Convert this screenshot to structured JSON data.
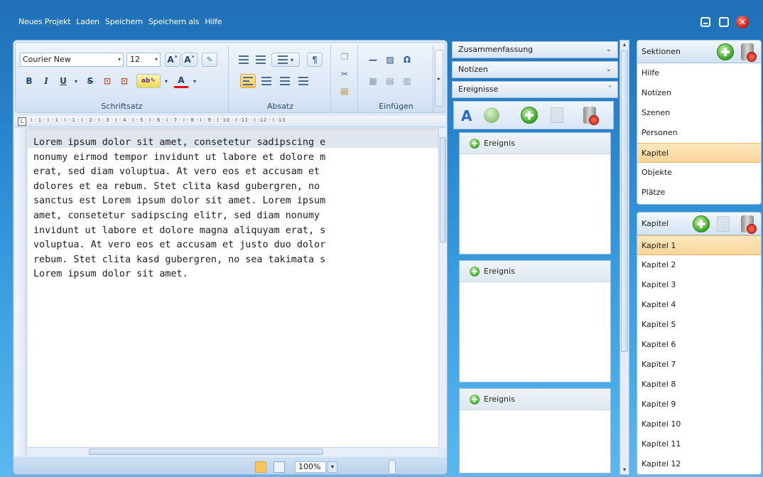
{
  "menu": {
    "items": [
      "Neues Projekt",
      "Laden",
      "Speichern",
      "Speichern als",
      "Hilfe"
    ],
    "close_glyph": "✕"
  },
  "ribbon": {
    "font_family": "Courier New",
    "font_size": "12",
    "groups": [
      "Schriftsatz",
      "Absatz",
      "Einfügen"
    ],
    "bold": "B",
    "italic": "I",
    "underline": "U",
    "strike": "S",
    "grow": "A˄",
    "shrink": "A˅",
    "font_color": "A"
  },
  "ruler": {
    "corner": "L",
    "ticks": "I · 1 · I · 1 · I · 1 · I · 2 · I · 3 · I · 4 · I · 5 · I · 6 · I · 7 · I · 8 · I · 9 · I ·10 · I ·11 · I ·12 · I ·13"
  },
  "document": {
    "text": "Lorem ipsum dolor sit amet, consetetur sadipscing e\nnonumy eirmod tempor invidunt ut labore et dolore m\nerat, sed diam voluptua. At vero eos et accusam et \ndolores et ea rebum. Stet clita kasd gubergren, no \nsanctus est Lorem ipsum dolor sit amet. Lorem ipsum\namet, consetetur sadipscing elitr, sed diam nonumy \ninvidunt ut labore et dolore magna aliquyam erat, s\nvoluptua. At vero eos et accusam et justo duo dolor\nrebum. Stet clita kasd gubergren, no sea takimata s\nLorem ipsum dolor sit amet."
  },
  "status": {
    "zoom": "100%",
    "zoom_dd": "▾"
  },
  "middle": {
    "sections": [
      {
        "label": "Zusammenfassung",
        "chevron": "⌄"
      },
      {
        "label": "Notizen",
        "chevron": "⌄"
      },
      {
        "label": "Ereignisse",
        "chevron": "˄"
      }
    ],
    "events": [
      "Ereignis",
      "Ereignis",
      "Ereignis"
    ]
  },
  "sektionen": {
    "title": "Sektionen",
    "items": [
      "Hilfe",
      "Notizen",
      "Szenen",
      "Personen",
      "Kapitel",
      "Objekte",
      "Plätze"
    ],
    "selected_index": 4
  },
  "kapitel": {
    "title": "Kapitel",
    "items": [
      "Kapitel 1",
      "Kapitel 2",
      "Kapitel 3",
      "Kapitel 4",
      "Kapitel 5",
      "Kapitel 6",
      "Kapitel 7",
      "Kapitel 8",
      "Kapitel 9",
      "Kapitel 10",
      "Kapitel 11",
      "Kapitel 12"
    ],
    "selected_index": 0
  },
  "colors": {
    "accent": "#2a86cf",
    "selection": "#f8d49a"
  }
}
